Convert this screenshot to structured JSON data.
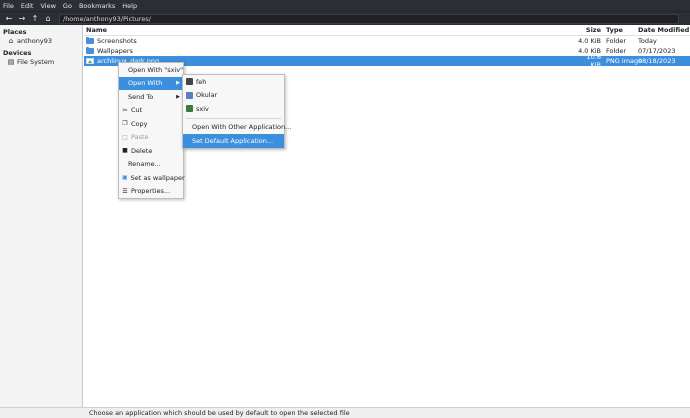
{
  "menubar": {
    "items": [
      "File",
      "Edit",
      "View",
      "Go",
      "Bookmarks",
      "Help"
    ]
  },
  "toolbar": {
    "back_icon": "arrow-left-icon",
    "forward_icon": "arrow-right-icon",
    "up_icon": "arrow-up-icon",
    "home_icon": "home-icon",
    "path": "/home/anthony93/Pictures/"
  },
  "sidebar": {
    "places_heading": "Places",
    "places": [
      {
        "label": "anthony93",
        "icon": "home-icon"
      }
    ],
    "devices_heading": "Devices",
    "devices": [
      {
        "label": "File System",
        "icon": "drive-icon"
      }
    ]
  },
  "filelist": {
    "headers": {
      "name": "Name",
      "size": "Size",
      "type": "Type",
      "date": "Date Modified"
    },
    "rows": [
      {
        "name": "Screenshots",
        "size": "4.0 KiB",
        "type": "Folder",
        "date": "Today",
        "icon": "folder-icon"
      },
      {
        "name": "Wallpapers",
        "size": "4.0 KiB",
        "type": "Folder",
        "date": "07/17/2023",
        "icon": "folder-icon"
      },
      {
        "name": "archlinux_dark.png",
        "size": "10.6 KiB",
        "type": "PNG image",
        "date": "08/18/2023",
        "icon": "image-icon",
        "selected": true
      }
    ]
  },
  "context_menu": {
    "open_with_default": "Open With \"sxiv\"",
    "open_with": "Open With",
    "send_to": "Send To",
    "cut": "Cut",
    "copy": "Copy",
    "paste": "Paste",
    "delete": "Delete",
    "rename": "Rename...",
    "set_wallpaper": "Set as wallpaper",
    "properties": "Properties..."
  },
  "submenu": {
    "apps": [
      {
        "label": "feh",
        "color": "#444444"
      },
      {
        "label": "Okular",
        "color": "#5a7fbf"
      },
      {
        "label": "sxiv",
        "color": "#3a7a3a"
      }
    ],
    "other": "Open With Other Application...",
    "set_default": "Set Default Application..."
  },
  "statusbar": {
    "text": "Choose an application which should be used by default to open the selected file"
  },
  "colors": {
    "accent": "#3b8fdd",
    "chrome": "#2b2e33"
  }
}
